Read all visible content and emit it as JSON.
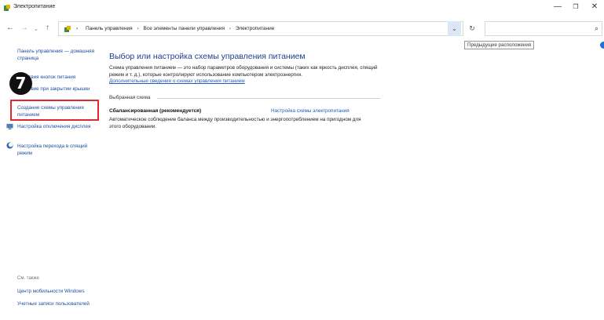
{
  "window": {
    "title": "Электропитание",
    "minimize": "—",
    "maximize": "❐",
    "close": "✕"
  },
  "nav": {
    "back": "←",
    "forward": "→",
    "recent": "⌄",
    "up": "↑",
    "breadcrumbs": [
      "Панель управления",
      "Все элементы панели управления",
      "Электропитание"
    ],
    "separator": "›",
    "dropdown": "⌄",
    "refresh": "↻",
    "search_glyph": "⌕",
    "tooltip": "Предыдущие расположения"
  },
  "sidebar": {
    "home": "Панель управления — домашняя страница",
    "item1": "Действия кнопок питания",
    "item2": "Действие при закрытии крышки",
    "create_plan": "Создание схемы управления питанием",
    "display_off": "Настройка отключения дисплея",
    "sleep": "Настройка перехода в спящий режим",
    "see_also": "См. также",
    "mobility": "Центр мобильности Windows",
    "accounts": "Учетные записи пользователей"
  },
  "step_badge": "7",
  "main": {
    "title": "Выбор или настройка схемы управления питанием",
    "description": "Схема управления питанием — это набор параметров оборудования и системы (таких как яркость дисплея, спящий режим и т. д.), которые контролируют использование компьютером электроэнергии.",
    "more_link": "Дополнительные сведения о схемах управления питанием",
    "group_label": "Выбранная схема",
    "plan_name": "Сбалансированная (рекомендуется)",
    "plan_settings": "Настройка схемы электропитания",
    "plan_description": "Автоматическое соблюдение баланса между производительностью и энергопотреблением на пригодном для этого оборудовании."
  },
  "colors": {
    "link": "#1f4ea1",
    "title": "#1e3f91",
    "highlight": "#e0282e",
    "badge": "#111111"
  }
}
